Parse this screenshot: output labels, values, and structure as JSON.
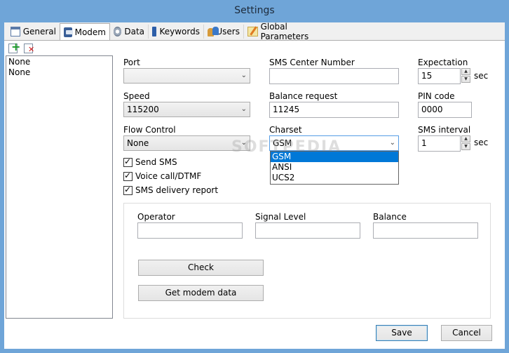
{
  "window": {
    "title": "Settings"
  },
  "tabs": [
    {
      "label": "General",
      "icon": "general-icon"
    },
    {
      "label": "Modem",
      "icon": "modem-icon"
    },
    {
      "label": "Data",
      "icon": "data-icon"
    },
    {
      "label": "Keywords",
      "icon": "keywords-icon"
    },
    {
      "label": "Users",
      "icon": "users-icon"
    },
    {
      "label": "Global Parameters",
      "icon": "global-parameters-icon"
    }
  ],
  "active_tab": "Modem",
  "modem_list": {
    "items": [
      "None",
      "None"
    ]
  },
  "fields": {
    "port": {
      "label": "Port",
      "value": ""
    },
    "speed": {
      "label": "Speed",
      "value": "115200"
    },
    "flow_control": {
      "label": "Flow Control",
      "value": "None"
    },
    "sms_center": {
      "label": "SMS Center Number",
      "value": ""
    },
    "balance_request": {
      "label": "Balance request",
      "value": "11245"
    },
    "charset": {
      "label": "Charset",
      "value": "GSM",
      "options": [
        "GSM",
        "ANSI",
        "UCS2"
      ]
    },
    "expectation": {
      "label": "Expectation",
      "value": "15",
      "unit": "sec"
    },
    "pin_code": {
      "label": "PIN code",
      "value": "0000"
    },
    "sms_interval": {
      "label": "SMS interval",
      "value": "1",
      "unit": "sec"
    }
  },
  "checkboxes": {
    "send_sms": {
      "label": "Send SMS",
      "checked": true
    },
    "voice_call": {
      "label": "Voice call/DTMF",
      "checked": true
    },
    "delivery_report": {
      "label": "SMS delivery report",
      "checked": true
    }
  },
  "status_group": {
    "operator": {
      "label": "Operator",
      "value": ""
    },
    "signal_level": {
      "label": "Signal Level",
      "value": ""
    },
    "balance": {
      "label": "Balance",
      "value": ""
    },
    "check_label": "Check",
    "get_data_label": "Get modem data"
  },
  "footer": {
    "save_label": "Save",
    "cancel_label": "Cancel"
  },
  "watermark": "SOFTPEDIA",
  "colors": {
    "frame": "#6fa5d8",
    "selection": "#0078d7",
    "add": "#1c9a2a",
    "delete": "#d21b1b"
  }
}
